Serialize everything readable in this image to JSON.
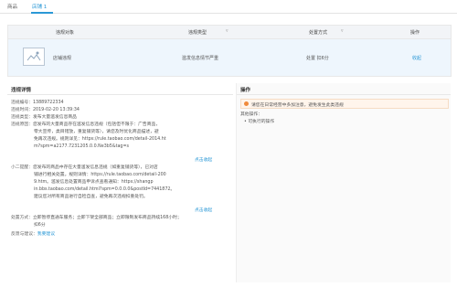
{
  "tabs": [
    {
      "label": "商品"
    },
    {
      "label": "店铺 1"
    }
  ],
  "table": {
    "headers": [
      "违规对象",
      "违规类型",
      "处置方式",
      "操作"
    ],
    "row": {
      "object": "店铺违规",
      "type": "滥发信息情节严重",
      "action": "处置 扣6分",
      "op": "收起"
    }
  },
  "details": {
    "title": "违规详情",
    "lines": [
      {
        "label": "违规编号：",
        "value": "13889722334"
      },
      {
        "label": "违规时间：",
        "value": "2019-02-20 13:39:34"
      },
      {
        "label": "违规类型：",
        "value": "发布大量滥发信息商品"
      },
      {
        "label": "违规原因：",
        "value": "您发布的大量商品存在滥发信息违规（包括但不限于：广告商品，"
      },
      {
        "label": "",
        "value": "零大宣传，类目错放，重复铺货等），请您及时优化商品描述，避"
      },
      {
        "label": "",
        "value": "免再次违规。规则详见：https://rule.taobao.com/detail-2014.ht"
      },
      {
        "label": "",
        "value": "m?spm=a2177.7231205.0.0.Ne3b5&tag=s"
      }
    ],
    "expand1": "点击收起",
    "tip": [
      {
        "label": "小二提醒：",
        "value": "您发布的商品中存在大量滥发信息违规（如重复铺货等），已对店"
      },
      {
        "label": "",
        "value": "铺进行相关处置。规则详情：https://rule.taobao.com/detail-200"
      },
      {
        "label": "",
        "value": "9.htm。滥发信息处置商品申诉点查看通知：https://shangp"
      },
      {
        "label": "",
        "value": "in.bbs.taobao.com/detail.html?spm=0.0.0.0&postId=7441872。"
      },
      {
        "label": "",
        "value": "建议您对所有商品进行自检自查，避免再次违规扣重处罚。"
      }
    ],
    "expand2": "点击收起",
    "measure": [
      {
        "label": "处置方式：",
        "value": "立即暂停直通车服务；立即下架全部商品；立即限制发布商品持续168小时；"
      },
      {
        "label": "",
        "value": "扣6分"
      }
    ],
    "feedback_label": "反馈与建议：",
    "feedback_link": "我要建议"
  },
  "operations": {
    "title": "操作",
    "notice": "请您在日常经营中多加注意，避免发生此类违规",
    "other_label": "其他操作：",
    "other_item": "• 可执行的操作"
  },
  "colors": {
    "accent": "#2a98d6",
    "notice": "#f08a3b"
  }
}
